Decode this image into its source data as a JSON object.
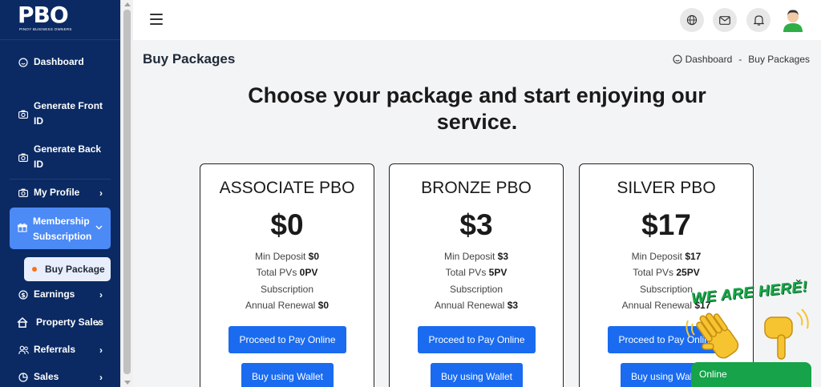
{
  "app": {
    "logo": "PBO",
    "logo_subtitle": "PINOY BUSINESS OWNERS"
  },
  "sidebar": {
    "items": [
      {
        "label": "Dashboard",
        "icon": "smile-icon"
      },
      {
        "label": "Generate Front ID",
        "label_l1": "Generate Front",
        "label_l2": "ID",
        "icon": "camera-icon"
      },
      {
        "label": "Generate Back ID",
        "label_l1": "Generate Back",
        "label_l2": "ID",
        "icon": "camera-icon"
      },
      {
        "label": "My Profile",
        "icon": "camera-icon"
      },
      {
        "label": "Membership Subscription",
        "label_l1": "Membership",
        "label_l2": "Subscription",
        "icon": "gift-icon",
        "expanded": true
      },
      {
        "label": "Buy Package",
        "icon": "dot-icon",
        "active": true
      },
      {
        "label": "Earnings",
        "icon": "dollar-icon"
      },
      {
        "label": "Property Sales",
        "icon": "home-icon"
      },
      {
        "label": "Referrals",
        "icon": "users-icon"
      },
      {
        "label": "Sales",
        "icon": "pie-chart-icon"
      }
    ]
  },
  "header": {
    "icons": [
      "language-icon",
      "mail-icon",
      "bell-icon",
      "user-avatar-icon"
    ]
  },
  "page": {
    "title": "Buy Packages",
    "breadcrumb": {
      "home": "Dashboard",
      "separator": "-",
      "current": "Buy Packages"
    },
    "headline_l1": "Choose your package and start enjoying our",
    "headline_l2": "service."
  },
  "packages": [
    {
      "name": "ASSOCIATE PBO",
      "price": "$0",
      "min_deposit_label": "Min Deposit",
      "min_deposit": "$0",
      "pvs_label": "Total PVs",
      "pvs": "0PV",
      "subscription": "Subscription",
      "renewal_label": "Annual Renewal",
      "renewal": "$0",
      "pay_label": "Proceed to Pay Online",
      "wallet_label": "Buy using Wallet"
    },
    {
      "name": "BRONZE PBO",
      "price": "$3",
      "min_deposit_label": "Min Deposit",
      "min_deposit": "$3",
      "pvs_label": "Total PVs",
      "pvs": "5PV",
      "subscription": "Subscription",
      "renewal_label": "Annual Renewal",
      "renewal": "$3",
      "pay_label": "Proceed to Pay Online",
      "wallet_label": "Buy using Wallet"
    },
    {
      "name": "SILVER PBO",
      "price": "$17",
      "min_deposit_label": "Min Deposit",
      "min_deposit": "$17",
      "pvs_label": "Total PVs",
      "pvs": "25PV",
      "subscription": "Subscription",
      "renewal_label": "Annual Renewal",
      "renewal": "$17",
      "pay_label": "Proceed to Pay Online",
      "wallet_label": "Buy using Wallet"
    }
  ],
  "chat": {
    "banner": "WE ARE HERE!",
    "status": "Online",
    "close": "×"
  },
  "colors": {
    "sidebar_bg": "#0b2a63",
    "active_item_bg": "#4c8af5",
    "primary_button": "#1a6bf0",
    "chat_green": "#16a34a"
  }
}
